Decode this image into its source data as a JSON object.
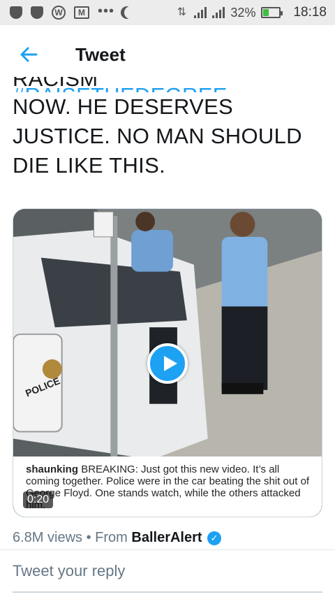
{
  "status_bar": {
    "battery_percent": "32%",
    "battery_level": 0.32,
    "time": "18:18",
    "icons": [
      "shield-icon",
      "shield-icon",
      "wordpress-icon",
      "gmail-icon",
      "more-icon",
      "moon-icon",
      "data-arrows-icon",
      "signal-icon",
      "signal-icon",
      "battery-icon"
    ]
  },
  "header": {
    "title": "Tweet",
    "back_icon": "back-arrow-icon"
  },
  "tweet": {
    "line1_plain": "RACISM ",
    "line1_hashtag": "#RAISETHEDEGREE",
    "line2": "NOW. HE DESERVES",
    "line3": "JUSTICE. NO MAN SHOULD",
    "line4": "DIE LIKE THIS."
  },
  "media": {
    "sign_text": "POLICE",
    "caption_user": "shaunking",
    "caption_text": "BREAKING: Just got this new video. It’s all coming together. Police were in the car beating the shit out of George Floyd. One stands watch, while the others attacked him.",
    "duration": "0:20",
    "play_icon": "play-icon"
  },
  "stats": {
    "views": "6.8M views",
    "separator": "•",
    "from_label": "From",
    "source": "BallerAlert"
  },
  "reply": {
    "placeholder": "Tweet your reply"
  },
  "colors": {
    "accent": "#1da1f2",
    "text": "#14171a",
    "muted": "#657786"
  }
}
